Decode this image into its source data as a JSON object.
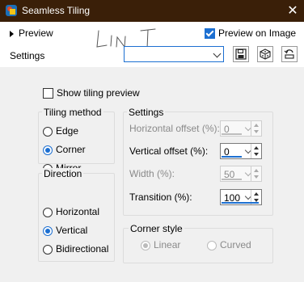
{
  "window": {
    "title": "Seamless Tiling",
    "close_symbol": "✕"
  },
  "header": {
    "preview_label": "Preview",
    "preview_on_image_label": "Preview on Image",
    "settings_label": "Settings",
    "preset_value": ""
  },
  "options": {
    "show_tiling_preview_label": "Show tiling preview"
  },
  "tiling_method": {
    "title": "Tiling method",
    "items": [
      {
        "label": "Edge"
      },
      {
        "label": "Corner"
      },
      {
        "label": "Mirror"
      }
    ]
  },
  "direction": {
    "title": "Direction",
    "items": [
      {
        "label": "Horizontal"
      },
      {
        "label": "Vertical"
      },
      {
        "label": "Bidirectional"
      }
    ]
  },
  "settings": {
    "title": "Settings",
    "fields": [
      {
        "label": "Horizontal offset (%):",
        "value": "0"
      },
      {
        "label": "Vertical offset (%):",
        "value": "0"
      },
      {
        "label": "Width (%):",
        "value": "50"
      },
      {
        "label": "Transition (%):",
        "value": "100"
      }
    ]
  },
  "corner_style": {
    "title": "Corner style",
    "items": [
      {
        "label": "Linear"
      },
      {
        "label": "Curved"
      }
    ]
  },
  "colors": {
    "titlebar": "#3a1f08",
    "accent": "#1c6fd1"
  }
}
